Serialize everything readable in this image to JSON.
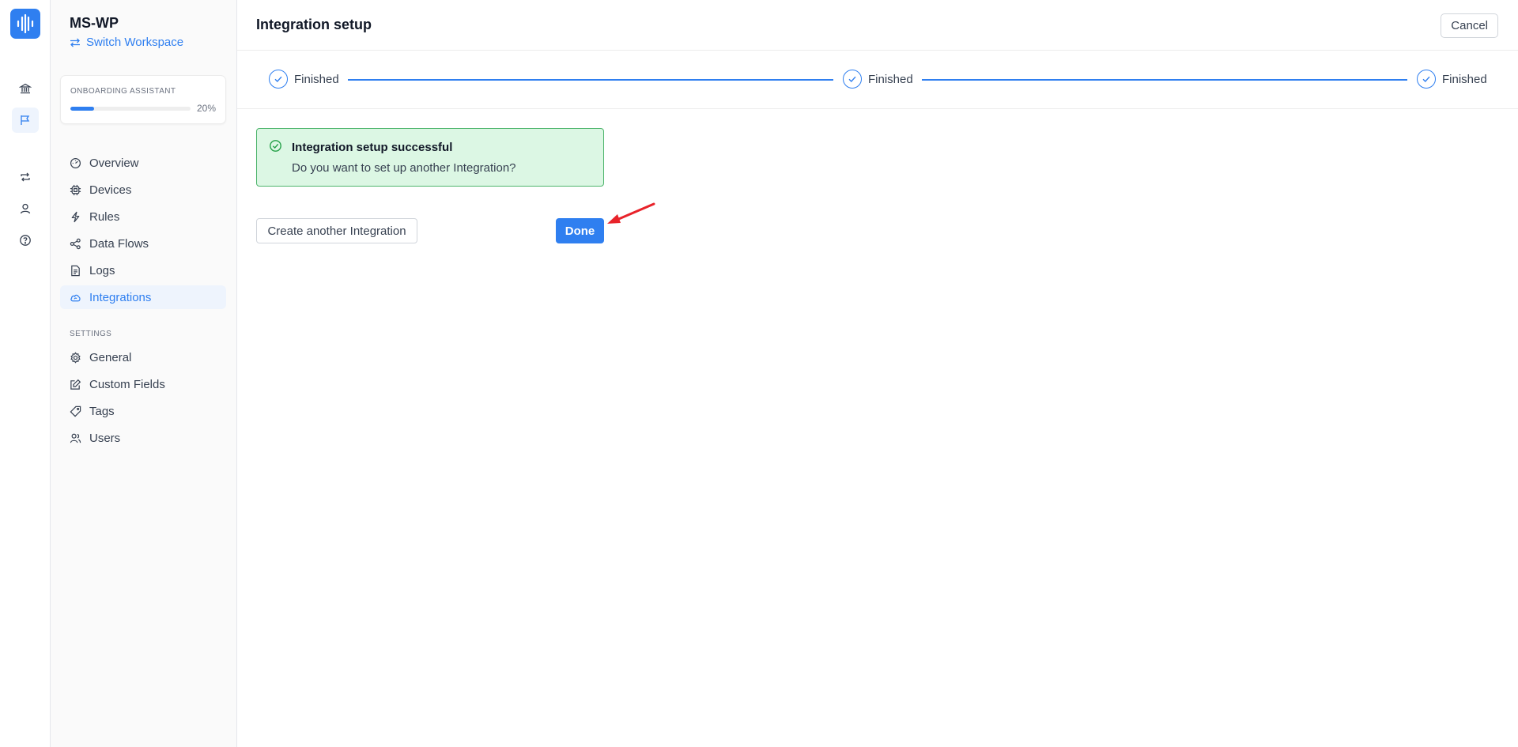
{
  "workspace": {
    "name": "MS-WP",
    "switch_label": "Switch Workspace"
  },
  "onboarding": {
    "label": "ONBOARDING ASSISTANT",
    "progress_text": "20%",
    "progress_value": 0.2
  },
  "nav": {
    "items": [
      {
        "label": "Overview",
        "icon": "gauge-icon"
      },
      {
        "label": "Devices",
        "icon": "chip-icon"
      },
      {
        "label": "Rules",
        "icon": "lightning-icon"
      },
      {
        "label": "Data Flows",
        "icon": "share-nodes-icon"
      },
      {
        "label": "Logs",
        "icon": "log-file-icon"
      },
      {
        "label": "Integrations",
        "icon": "cloud-sync-icon",
        "active": true
      }
    ],
    "settings_label": "SETTINGS",
    "settings_items": [
      {
        "label": "General",
        "icon": "gear-icon"
      },
      {
        "label": "Custom Fields",
        "icon": "edit-square-icon"
      },
      {
        "label": "Tags",
        "icon": "tag-icon"
      },
      {
        "label": "Users",
        "icon": "users-icon"
      }
    ]
  },
  "rail": {
    "icons": [
      "app-logo-icon",
      "bank-icon",
      "flag-icon",
      "repeat-icon",
      "user-icon",
      "help-circle-icon"
    ]
  },
  "header": {
    "title": "Integration setup",
    "cancel_label": "Cancel"
  },
  "stepper": {
    "steps": [
      {
        "label": "Finished"
      },
      {
        "label": "Finished"
      },
      {
        "label": "Finished"
      }
    ]
  },
  "alert": {
    "title": "Integration setup successful",
    "body": "Do you want to set up another Integration?"
  },
  "actions": {
    "secondary_label": "Create another Integration",
    "primary_label": "Done"
  },
  "colors": {
    "accent": "#2f7ff0",
    "success_bg": "#dcf7e4",
    "success_border": "#4fb56d",
    "annotation_arrow": "#e8232a"
  }
}
